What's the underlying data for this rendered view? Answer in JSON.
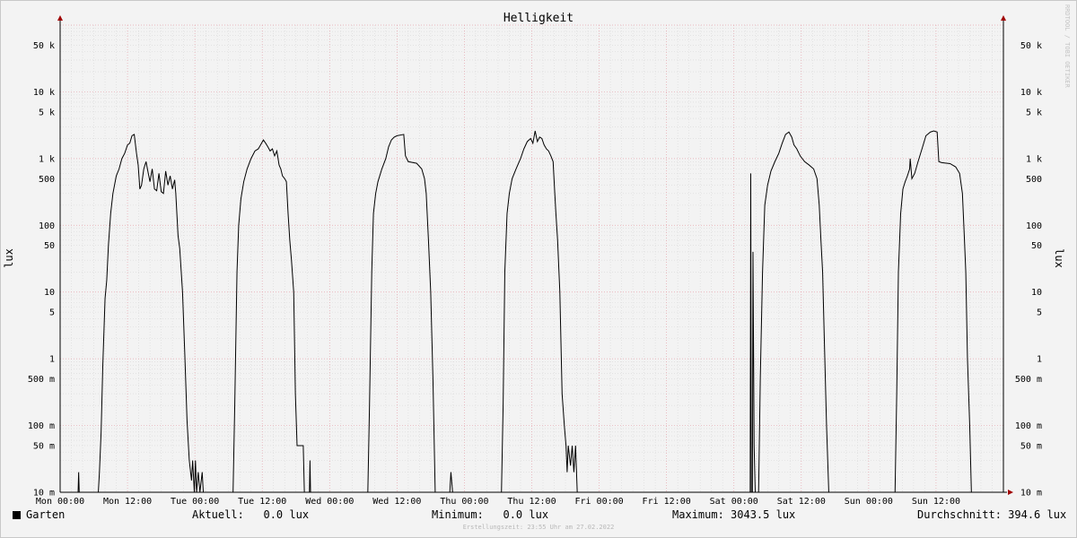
{
  "chart_data": {
    "type": "line",
    "title": "Helligkeit",
    "ylabel": "lux",
    "yscale": "log",
    "ylim": [
      0.01,
      100000
    ],
    "y_tick_labels": [
      "10 m",
      "50 m",
      "100 m",
      "500 m",
      "1",
      "5",
      "10",
      "50",
      "100",
      "500",
      "1 k",
      "5 k",
      "10 k",
      "50 k"
    ],
    "y_tick_values": [
      0.01,
      0.05,
      0.1,
      0.5,
      1,
      5,
      10,
      50,
      100,
      500,
      1000,
      5000,
      10000,
      50000
    ],
    "x_tick_labels": [
      "Mon 00:00",
      "Mon 12:00",
      "Tue 00:00",
      "Tue 12:00",
      "Wed 00:00",
      "Wed 12:00",
      "Thu 00:00",
      "Thu 12:00",
      "Fri 00:00",
      "Fri 12:00",
      "Sat 00:00",
      "Sat 12:00",
      "Sun 00:00",
      "Sun 12:00"
    ],
    "x_tick_values_hours": [
      0,
      12,
      24,
      36,
      48,
      60,
      72,
      84,
      96,
      108,
      120,
      132,
      144,
      156
    ],
    "xlim_hours": [
      0,
      168
    ],
    "grid": true,
    "legend_position": "bottom-left",
    "series": [
      {
        "name": "Garten",
        "color": "#000000",
        "points": [
          [
            0,
            0.01
          ],
          [
            3.2,
            0.01
          ],
          [
            3.3,
            0.02
          ],
          [
            3.4,
            0.01
          ],
          [
            6.8,
            0.01
          ],
          [
            7,
            0.02
          ],
          [
            7.3,
            0.08
          ],
          [
            7.6,
            0.8
          ],
          [
            8,
            8
          ],
          [
            8.3,
            15
          ],
          [
            8.6,
            50
          ],
          [
            9,
            150
          ],
          [
            9.4,
            300
          ],
          [
            10,
            550
          ],
          [
            10.5,
            700
          ],
          [
            11,
            1000
          ],
          [
            11.5,
            1200
          ],
          [
            12,
            1600
          ],
          [
            12.4,
            1700
          ],
          [
            12.8,
            2200
          ],
          [
            13.2,
            2300
          ],
          [
            13.6,
            1200
          ],
          [
            13.9,
            800
          ],
          [
            14.2,
            350
          ],
          [
            14.5,
            400
          ],
          [
            14.9,
            700
          ],
          [
            15.3,
            900
          ],
          [
            15.7,
            600
          ],
          [
            16,
            450
          ],
          [
            16.4,
            700
          ],
          [
            16.8,
            350
          ],
          [
            17.2,
            330
          ],
          [
            17.6,
            600
          ],
          [
            18,
            320
          ],
          [
            18.4,
            300
          ],
          [
            18.8,
            650
          ],
          [
            19.2,
            400
          ],
          [
            19.6,
            550
          ],
          [
            20,
            350
          ],
          [
            20.4,
            480
          ],
          [
            20.6,
            300
          ],
          [
            21,
            70
          ],
          [
            21.3,
            45
          ],
          [
            21.8,
            10
          ],
          [
            22.2,
            1.2
          ],
          [
            22.6,
            0.12
          ],
          [
            23,
            0.03
          ],
          [
            23.4,
            0.015
          ],
          [
            23.6,
            0.03
          ],
          [
            23.9,
            0.01
          ],
          [
            24.1,
            0.03
          ],
          [
            24.3,
            0.01
          ],
          [
            24.6,
            0.02
          ],
          [
            24.9,
            0.01
          ],
          [
            25.3,
            0.02
          ],
          [
            25.5,
            0.01
          ],
          [
            30.8,
            0.01
          ],
          [
            31.1,
            0.2
          ],
          [
            31.5,
            20
          ],
          [
            31.8,
            100
          ],
          [
            32.2,
            250
          ],
          [
            32.7,
            450
          ],
          [
            33.3,
            700
          ],
          [
            34,
            1000
          ],
          [
            34.7,
            1300
          ],
          [
            35.3,
            1400
          ],
          [
            35.7,
            1600
          ],
          [
            36.2,
            1900
          ],
          [
            36.6,
            1700
          ],
          [
            37,
            1500
          ],
          [
            37.4,
            1300
          ],
          [
            37.8,
            1400
          ],
          [
            38.2,
            1100
          ],
          [
            38.6,
            1300
          ],
          [
            39,
            800
          ],
          [
            39.3,
            700
          ],
          [
            39.6,
            550
          ],
          [
            40,
            500
          ],
          [
            40.3,
            450
          ],
          [
            40.6,
            150
          ],
          [
            40.9,
            60
          ],
          [
            41.2,
            30
          ],
          [
            41.6,
            10
          ],
          [
            41.9,
            0.3
          ],
          [
            42.2,
            0.05
          ],
          [
            43.3,
            0.05
          ],
          [
            43.5,
            0.01
          ],
          [
            44.4,
            0.01
          ],
          [
            44.5,
            0.03
          ],
          [
            44.6,
            0.01
          ],
          [
            54.8,
            0.01
          ],
          [
            55.1,
            0.2
          ],
          [
            55.5,
            20
          ],
          [
            55.8,
            150
          ],
          [
            56.2,
            300
          ],
          [
            56.6,
            450
          ],
          [
            57.3,
            700
          ],
          [
            58,
            1000
          ],
          [
            58.5,
            1500
          ],
          [
            59,
            1900
          ],
          [
            59.5,
            2100
          ],
          [
            60,
            2200
          ],
          [
            61.2,
            2300
          ],
          [
            61.5,
            1100
          ],
          [
            62,
            900
          ],
          [
            63.5,
            850
          ],
          [
            64.4,
            700
          ],
          [
            64.9,
            500
          ],
          [
            65.2,
            300
          ],
          [
            65.6,
            60
          ],
          [
            66,
            10
          ],
          [
            66.4,
            0.5
          ],
          [
            66.8,
            0.01
          ],
          [
            67,
            0.01
          ],
          [
            67.1,
            0.01
          ],
          [
            69.4,
            0.01
          ],
          [
            69.6,
            0.02
          ],
          [
            69.9,
            0.01
          ],
          [
            72,
            0.01
          ],
          [
            78.6,
            0.01
          ],
          [
            78.9,
            0.2
          ],
          [
            79.2,
            20
          ],
          [
            79.6,
            150
          ],
          [
            80,
            300
          ],
          [
            80.5,
            500
          ],
          [
            81.2,
            700
          ],
          [
            82,
            1000
          ],
          [
            82.6,
            1400
          ],
          [
            83.2,
            1800
          ],
          [
            83.8,
            2000
          ],
          [
            84.2,
            1700
          ],
          [
            84.6,
            2600
          ],
          [
            85,
            1800
          ],
          [
            85.4,
            2100
          ],
          [
            85.8,
            2000
          ],
          [
            86.2,
            1600
          ],
          [
            86.6,
            1400
          ],
          [
            87,
            1300
          ],
          [
            87.4,
            1100
          ],
          [
            87.8,
            900
          ],
          [
            88.1,
            300
          ],
          [
            88.3,
            150
          ],
          [
            88.6,
            60
          ],
          [
            89,
            10
          ],
          [
            89.4,
            0.3
          ],
          [
            89.8,
            0.1
          ],
          [
            90.1,
            0.05
          ],
          [
            90.3,
            0.02
          ],
          [
            90.5,
            0.05
          ],
          [
            90.9,
            0.025
          ],
          [
            91.2,
            0.05
          ],
          [
            91.5,
            0.02
          ],
          [
            91.8,
            0.05
          ],
          [
            92.1,
            0.01
          ],
          [
            122.9,
            0.01
          ],
          [
            123,
            600
          ],
          [
            123.1,
            0.01
          ],
          [
            123.3,
            0.01
          ],
          [
            123.4,
            40
          ],
          [
            123.6,
            0.05
          ],
          [
            123.8,
            0.01
          ],
          [
            124.4,
            0.01
          ],
          [
            124.7,
            0.5
          ],
          [
            125.1,
            20
          ],
          [
            125.5,
            200
          ],
          [
            126,
            400
          ],
          [
            126.6,
            650
          ],
          [
            127.3,
            900
          ],
          [
            128,
            1200
          ],
          [
            128.6,
            1700
          ],
          [
            129.2,
            2300
          ],
          [
            129.8,
            2500
          ],
          [
            130.3,
            2100
          ],
          [
            130.7,
            1600
          ],
          [
            131.2,
            1400
          ],
          [
            131.8,
            1100
          ],
          [
            132.6,
            900
          ],
          [
            133.4,
            800
          ],
          [
            134.2,
            700
          ],
          [
            134.8,
            500
          ],
          [
            135.2,
            200
          ],
          [
            135.5,
            60
          ],
          [
            135.8,
            20
          ],
          [
            136.1,
            2
          ],
          [
            136.5,
            0.1
          ],
          [
            136.9,
            0.01
          ],
          [
            148.7,
            0.01
          ],
          [
            149,
            0.3
          ],
          [
            149.3,
            20
          ],
          [
            149.7,
            150
          ],
          [
            150.1,
            350
          ],
          [
            150.5,
            450
          ],
          [
            150.9,
            550
          ],
          [
            151.3,
            700
          ],
          [
            151.4,
            1000
          ],
          [
            151.7,
            500
          ],
          [
            152.2,
            600
          ],
          [
            152.8,
            900
          ],
          [
            153.5,
            1400
          ],
          [
            154.2,
            2200
          ],
          [
            155,
            2500
          ],
          [
            155.6,
            2600
          ],
          [
            156.2,
            2500
          ],
          [
            156.5,
            900
          ],
          [
            157,
            870
          ],
          [
            158.5,
            840
          ],
          [
            159.5,
            750
          ],
          [
            160.2,
            600
          ],
          [
            160.7,
            300
          ],
          [
            161,
            80
          ],
          [
            161.3,
            20
          ],
          [
            161.6,
            1
          ],
          [
            162,
            0.1
          ],
          [
            162.3,
            0.01
          ],
          [
            168,
            0.01
          ]
        ]
      }
    ]
  },
  "legend": {
    "series_name": "Garten",
    "aktuell": "Aktuell:   0.0 lux",
    "minimum": "Minimum:   0.0 lux",
    "maximum": "Maximum: 3043.5 lux",
    "durchschnitt": "Durchschnitt: 394.6 lux"
  },
  "footer": "Erstellungszeit: 23:55 Uhr am 27.02.2022",
  "watermark": "RRDTOOL / TOBI OETIKER"
}
